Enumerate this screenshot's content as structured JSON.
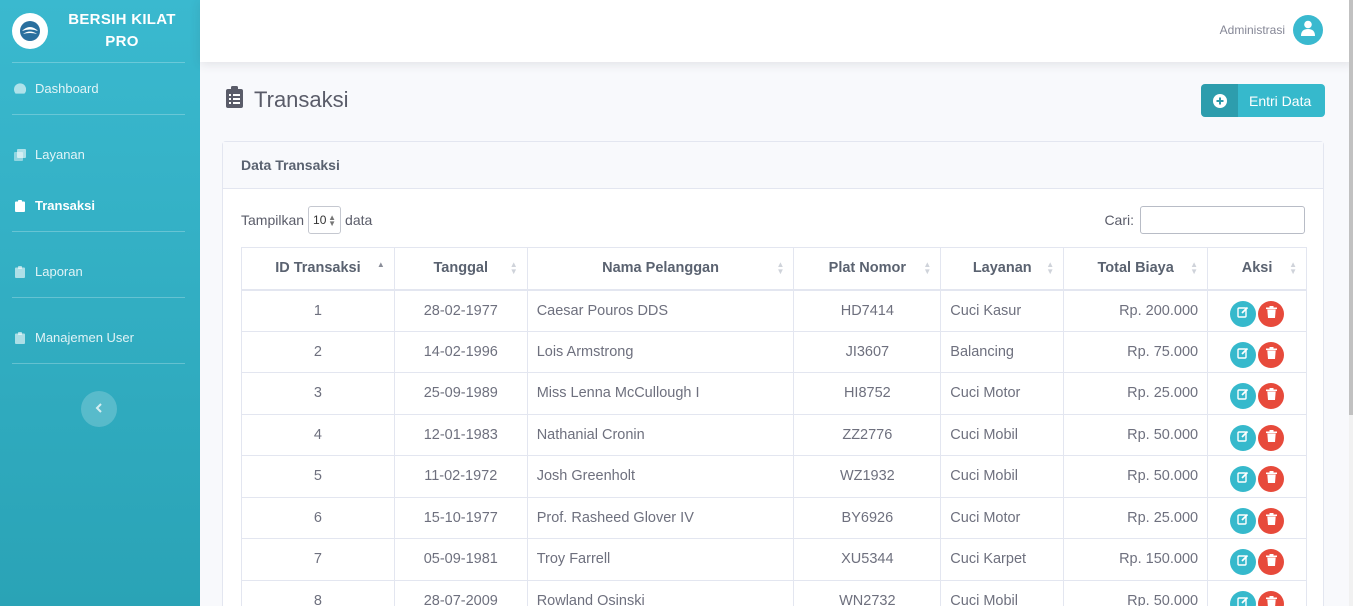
{
  "brand": {
    "name": "BERSIH KILAT PRO"
  },
  "sidebar": {
    "items": [
      {
        "label": "Dashboard",
        "icon": "dashboard-icon",
        "active": false
      },
      {
        "label": "Layanan",
        "icon": "copy-icon",
        "active": false
      },
      {
        "label": "Transaksi",
        "icon": "clipboard-icon",
        "active": true
      },
      {
        "label": "Laporan",
        "icon": "clipboard-icon",
        "active": false
      },
      {
        "label": "Manajemen User",
        "icon": "clipboard-icon",
        "active": false
      }
    ]
  },
  "topbar": {
    "user_name": "Administrasi"
  },
  "page": {
    "title": "Transaksi",
    "entri_label": "Entri Data"
  },
  "card": {
    "title": "Data Transaksi",
    "length_prefix": "Tampilkan",
    "length_value": "10",
    "length_suffix": "data",
    "search_label": "Cari:",
    "search_value": ""
  },
  "table": {
    "headers": [
      "ID Transaksi",
      "Tanggal",
      "Nama Pelanggan",
      "Plat Nomor",
      "Layanan",
      "Total Biaya",
      "Aksi"
    ],
    "rows": [
      [
        "1",
        "28-02-1977",
        "Caesar Pouros DDS",
        "HD7414",
        "Cuci Kasur",
        "Rp. 200.000"
      ],
      [
        "2",
        "14-02-1996",
        "Lois Armstrong",
        "JI3607",
        "Balancing",
        "Rp. 75.000"
      ],
      [
        "3",
        "25-09-1989",
        "Miss Lenna McCullough I",
        "HI8752",
        "Cuci Motor",
        "Rp. 25.000"
      ],
      [
        "4",
        "12-01-1983",
        "Nathanial Cronin",
        "ZZ2776",
        "Cuci Mobil",
        "Rp. 50.000"
      ],
      [
        "5",
        "11-02-1972",
        "Josh Greenholt",
        "WZ1932",
        "Cuci Mobil",
        "Rp. 50.000"
      ],
      [
        "6",
        "15-10-1977",
        "Prof. Rasheed Glover IV",
        "BY6926",
        "Cuci Motor",
        "Rp. 25.000"
      ],
      [
        "7",
        "05-09-1981",
        "Troy Farrell",
        "XU5344",
        "Cuci Karpet",
        "Rp. 150.000"
      ],
      [
        "8",
        "28-07-2009",
        "Rowland Osinski",
        "WN2732",
        "Cuci Mobil",
        "Rp. 50.000"
      ]
    ]
  },
  "colors": {
    "primary": "#36b9cc",
    "danger": "#e74a3b",
    "sidebar": "#3ab9cf"
  }
}
